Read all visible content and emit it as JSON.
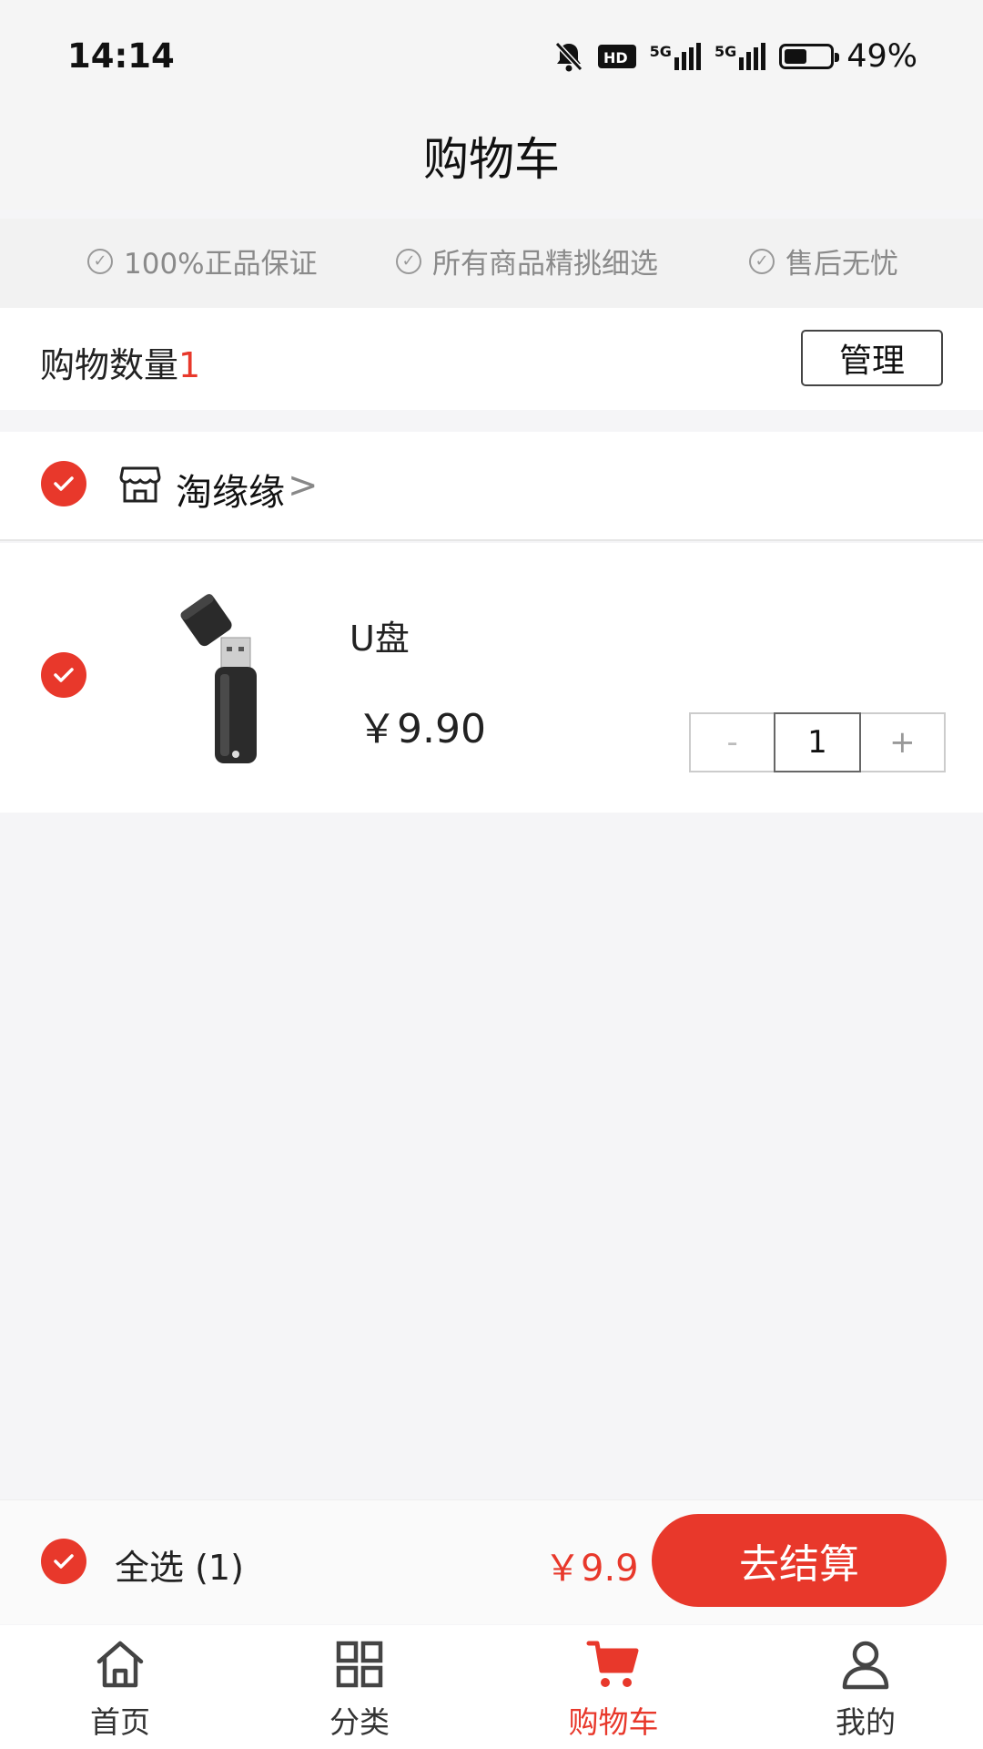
{
  "status_bar": {
    "time": "14:14",
    "net1": "5G",
    "net2": "5G",
    "battery_percent": "49%",
    "battery_level": 0.49
  },
  "header": {
    "title": "购物车"
  },
  "guarantees": [
    "100%正品保证",
    "所有商品精挑细选",
    "售后无忧"
  ],
  "cart_summary": {
    "count_label": "购物数量",
    "count_value": "1",
    "manage_label": "管理"
  },
  "store": {
    "name": "淘缘缘",
    "chevron": ">"
  },
  "product": {
    "name": "U盘",
    "price": "￥9.90",
    "quantity": "1",
    "minus": "-",
    "plus": "+"
  },
  "checkout": {
    "select_all_label": "全选 (1)",
    "total": "￥9.9",
    "button_label": "去结算"
  },
  "tabs": [
    {
      "label": "首页",
      "icon": "home-icon"
    },
    {
      "label": "分类",
      "icon": "grid-icon"
    },
    {
      "label": "购物车",
      "icon": "cart-icon",
      "active": true
    },
    {
      "label": "我的",
      "icon": "user-icon"
    }
  ],
  "colors": {
    "accent": "#e8382b",
    "background": "#f5f5f7"
  }
}
